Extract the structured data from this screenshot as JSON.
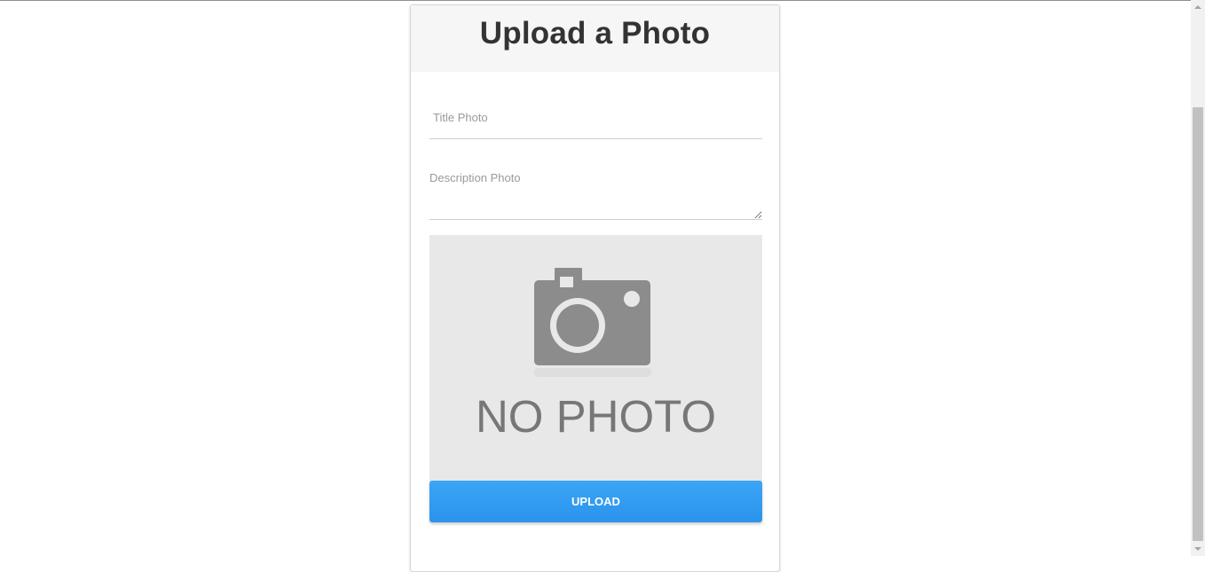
{
  "form": {
    "heading": "Upload a Photo",
    "title_field": {
      "placeholder": "Title Photo",
      "value": ""
    },
    "description_field": {
      "placeholder": "Description Photo",
      "value": ""
    },
    "photo_placeholder": {
      "icon": "camera-icon",
      "text": "NO PHOTO"
    },
    "upload_button_label": "UPLOAD"
  },
  "colors": {
    "button": "#2f9cf0",
    "header_background": "#f6f6f6",
    "placeholder_background": "#e8e8e8"
  }
}
